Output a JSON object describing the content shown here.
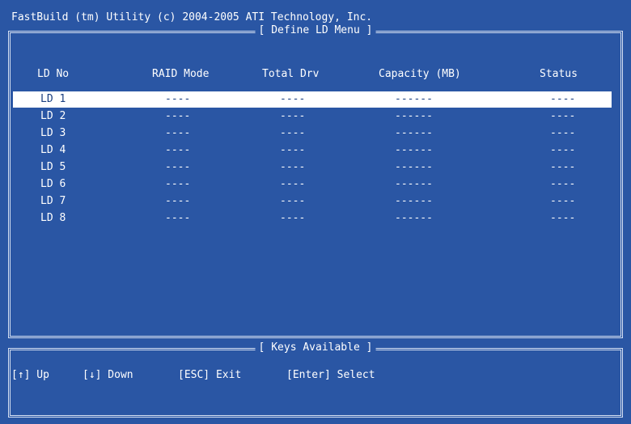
{
  "window": {
    "title": "FastBuild (tm) Utility (c) 2004-2005 ATI Technology, Inc."
  },
  "menu": {
    "title": "[ Define LD Menu ]",
    "columns": [
      "LD No",
      "RAID Mode",
      "Total Drv",
      "Capacity (MB)",
      "Status"
    ],
    "rows": [
      {
        "ld": "LD 1",
        "raid": "----",
        "drv": "----",
        "cap": "------",
        "status": "----",
        "selected": true
      },
      {
        "ld": "LD 2",
        "raid": "----",
        "drv": "----",
        "cap": "------",
        "status": "----",
        "selected": false
      },
      {
        "ld": "LD 3",
        "raid": "----",
        "drv": "----",
        "cap": "------",
        "status": "----",
        "selected": false
      },
      {
        "ld": "LD 4",
        "raid": "----",
        "drv": "----",
        "cap": "------",
        "status": "----",
        "selected": false
      },
      {
        "ld": "LD 5",
        "raid": "----",
        "drv": "----",
        "cap": "------",
        "status": "----",
        "selected": false
      },
      {
        "ld": "LD 6",
        "raid": "----",
        "drv": "----",
        "cap": "------",
        "status": "----",
        "selected": false
      },
      {
        "ld": "LD 7",
        "raid": "----",
        "drv": "----",
        "cap": "------",
        "status": "----",
        "selected": false
      },
      {
        "ld": "LD 8",
        "raid": "----",
        "drv": "----",
        "cap": "------",
        "status": "----",
        "selected": false
      }
    ]
  },
  "keys": {
    "title": "[ Keys Available ]",
    "up": "[↑] Up",
    "down": "[↓] Down",
    "exit": "[ESC] Exit",
    "select": "[Enter] Select"
  },
  "colors": {
    "background": "#2a56a4",
    "text": "#ffffff",
    "selected_bg": "#ffffff",
    "selected_text": "#1a3f80"
  }
}
